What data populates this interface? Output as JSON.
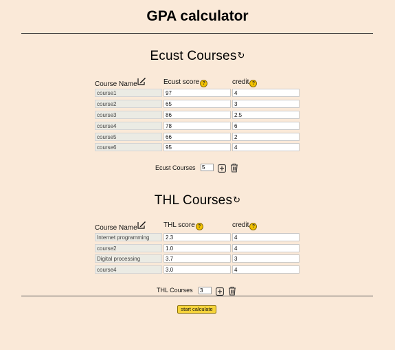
{
  "page_title": "GPA calculator",
  "ecust": {
    "title": "Ecust Courses",
    "headers": {
      "name": "Course Name",
      "score": "Ecust score",
      "credit": "credit"
    },
    "rows": [
      {
        "name": "course1",
        "score": "97",
        "credit": "4"
      },
      {
        "name": "course2",
        "score": "65",
        "credit": "3"
      },
      {
        "name": "course3",
        "score": "86",
        "credit": "2.5"
      },
      {
        "name": "course4",
        "score": "78",
        "credit": "6"
      },
      {
        "name": "course5",
        "score": "66",
        "credit": "2"
      },
      {
        "name": "course6",
        "score": "95",
        "credit": "4"
      }
    ],
    "count_label": "Ecust Courses",
    "count_value": "5"
  },
  "thl": {
    "title": "THL Courses",
    "headers": {
      "name": "Course Name",
      "score": "THL score",
      "credit": "credit"
    },
    "rows": [
      {
        "name": "Internet programming",
        "score": "2.3",
        "credit": "4"
      },
      {
        "name": "course2",
        "score": "1.0",
        "credit": "4"
      },
      {
        "name": "Digital processing",
        "score": "3.7",
        "credit": "3"
      },
      {
        "name": "course4",
        "score": "3.0",
        "credit": "4"
      }
    ],
    "count_label": "THL Courses",
    "count_value": "3"
  },
  "start_button": "start calculate",
  "icons": {
    "reset": "reset-icon",
    "edit": "edit-icon",
    "help": "help-icon",
    "add": "add-icon",
    "delete": "trash-icon"
  },
  "colors": {
    "background": "#fae9d8",
    "button": "#f5d33a",
    "help_icon": "#f2c200"
  }
}
